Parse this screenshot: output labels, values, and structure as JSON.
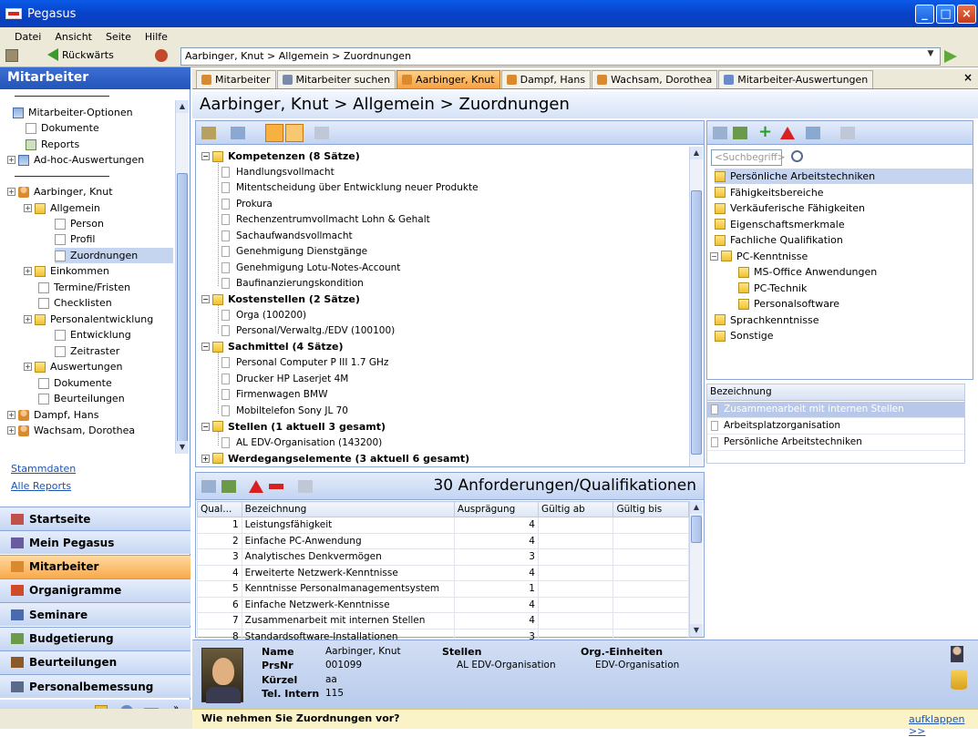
{
  "window": {
    "title": "Pegasus"
  },
  "menu": [
    "Datei",
    "Ansicht",
    "Seite",
    "Hilfe"
  ],
  "nav": {
    "back_label": "Rückwärts",
    "address": "Aarbinger, Knut > Allgemein > Zuordnungen"
  },
  "left": {
    "title": "Mitarbeiter",
    "tree": [
      {
        "label": "Mitarbeiter-Optionen",
        "icon": "table-icon"
      },
      {
        "label": "Dokumente",
        "icon": "document-icon"
      },
      {
        "label": "Reports",
        "icon": "report-icon"
      },
      {
        "label": "Ad-hoc-Auswertungen",
        "icon": "table-icon"
      },
      {
        "label": "Aarbinger, Knut",
        "icon": "person-icon"
      },
      {
        "label": "Allgemein",
        "icon": "folder-icon"
      },
      {
        "label": "Person",
        "icon": "document-icon"
      },
      {
        "label": "Profil",
        "icon": "document-icon"
      },
      {
        "label": "Zuordnungen",
        "icon": "document-icon",
        "selected": true
      },
      {
        "label": "Einkommen",
        "icon": "folder-icon"
      },
      {
        "label": "Termine/Fristen",
        "icon": "document-icon"
      },
      {
        "label": "Checklisten",
        "icon": "document-icon"
      },
      {
        "label": "Personalentwicklung",
        "icon": "folder-icon"
      },
      {
        "label": "Entwicklung",
        "icon": "document-icon"
      },
      {
        "label": "Zeitraster",
        "icon": "document-icon"
      },
      {
        "label": "Auswertungen",
        "icon": "folder-icon"
      },
      {
        "label": "Dokumente",
        "icon": "document-icon"
      },
      {
        "label": "Beurteilungen",
        "icon": "document-icon"
      },
      {
        "label": "Dampf, Hans",
        "icon": "person-icon"
      },
      {
        "label": "Wachsam, Dorothea",
        "icon": "person-icon"
      }
    ],
    "links": [
      "Stammdaten",
      "Alle Reports"
    ],
    "nav_buttons": [
      {
        "label": "Startseite",
        "icon": "home-icon"
      },
      {
        "label": "Mein Pegasus",
        "icon": "pegasus-icon"
      },
      {
        "label": "Mitarbeiter",
        "icon": "person-icon",
        "active": true
      },
      {
        "label": "Organigramme",
        "icon": "org-chart-icon"
      },
      {
        "label": "Seminare",
        "icon": "seminar-icon"
      },
      {
        "label": "Budgetierung",
        "icon": "money-icon"
      },
      {
        "label": "Beurteilungen",
        "icon": "appraisal-icon"
      },
      {
        "label": "Personalbemessung",
        "icon": "staffing-icon"
      }
    ]
  },
  "tabs": [
    {
      "label": "Mitarbeiter",
      "icon": "person-icon"
    },
    {
      "label": "Mitarbeiter suchen",
      "icon": "search-icon"
    },
    {
      "label": "Aarbinger, Knut",
      "icon": "person-icon",
      "active": true
    },
    {
      "label": "Dampf, Hans",
      "icon": "person-icon"
    },
    {
      "label": "Wachsam, Dorothea",
      "icon": "person-icon"
    },
    {
      "label": "Mitarbeiter-Auswertungen",
      "icon": "table-icon"
    }
  ],
  "header": {
    "breadcrumb": "Aarbinger, Knut > Allgemein > Zuordnungen"
  },
  "assignments": [
    {
      "group": "Kompetenzen (8 Sätze)",
      "items": [
        "Handlungsvollmacht",
        "Mitentscheidung über Entwicklung neuer Produkte",
        "Prokura",
        "Rechenzentrumvollmacht Lohn & Gehalt",
        "Sachaufwandsvollmacht",
        "Genehmigung Dienstgänge",
        "Genehmigung Lotu-Notes-Account",
        "Baufinanzierungskondition"
      ]
    },
    {
      "group": "Kostenstellen (2 Sätze)",
      "items": [
        "Orga (100200)",
        "Personal/Verwaltg./EDV (100100)"
      ]
    },
    {
      "group": "Sachmittel (4 Sätze)",
      "items": [
        "Personal Computer P III 1.7 GHz",
        "Drucker HP Laserjet 4M",
        "Firmenwagen BMW",
        "Mobiltelefon Sony JL 70"
      ]
    },
    {
      "group": "Stellen (1 aktuell 3 gesamt)",
      "items": [
        "AL EDV-Organisation (143200)"
      ]
    },
    {
      "group": "Werdegangselemente (3 aktuell 6 gesamt)",
      "items": []
    }
  ],
  "catalog": {
    "search_placeholder": "<Suchbegriff>",
    "items": [
      {
        "label": "Persönliche Arbeitstechniken",
        "level": 0,
        "selected": true
      },
      {
        "label": "Fähigkeitsbereiche",
        "level": 0
      },
      {
        "label": "Verkäuferische Fähigkeiten",
        "level": 0
      },
      {
        "label": "Eigenschaftsmerkmale",
        "level": 0
      },
      {
        "label": "Fachliche Qualifikation",
        "level": 0
      },
      {
        "label": "PC-Kenntnisse",
        "level": 0
      },
      {
        "label": "MS-Office Anwendungen",
        "level": 1
      },
      {
        "label": "PC-Technik",
        "level": 1
      },
      {
        "label": "Personalsoftware",
        "level": 1
      },
      {
        "label": "Sprachkenntnisse",
        "level": 0
      },
      {
        "label": "Sonstige",
        "level": 0
      }
    ],
    "list_header": "Bezeichnung",
    "list": [
      "Zusammenarbeit mit internen Stellen",
      "Arbeitsplatzorganisation",
      "Persönliche Arbeitstechniken"
    ]
  },
  "requirements": {
    "title": "30 Anforderungen/Qualifikationen",
    "columns": [
      "Qual...",
      "Bezeichnung",
      "Ausprägung",
      "Gültig ab",
      "Gültig bis"
    ],
    "rows": [
      [
        "1",
        "Leistungsfähigkeit",
        "4",
        "",
        ""
      ],
      [
        "2",
        "Einfache PC-Anwendung",
        "4",
        "",
        ""
      ],
      [
        "3",
        "Analytisches Denkvermögen",
        "3",
        "",
        ""
      ],
      [
        "4",
        "Erweiterte Netzwerk-Kenntnisse",
        "4",
        "",
        ""
      ],
      [
        "5",
        "Kenntnisse Personalmanagementsystem",
        "1",
        "",
        ""
      ],
      [
        "6",
        "Einfache Netzwerk-Kenntnisse",
        "4",
        "",
        ""
      ],
      [
        "7",
        "Zusammenarbeit mit internen Stellen",
        "4",
        "",
        ""
      ],
      [
        "8",
        "Standardsoftware-Installationen",
        "3",
        "",
        ""
      ]
    ]
  },
  "employee": {
    "name_label": "Name",
    "name": "Aarbinger, Knut",
    "prsnr_label": "PrsNr",
    "prsnr": "001099",
    "kuerzel_label": "Kürzel",
    "kuerzel": "aa",
    "tel_label": "Tel. Intern",
    "tel": "115",
    "stellen_label": "Stellen",
    "stellen": "AL EDV-Organisation",
    "org_label": "Org.-Einheiten",
    "org": "EDV-Organisation"
  },
  "footer": {
    "question": "Wie nehmen Sie Zuordnungen vor?",
    "expand": "aufklappen >>"
  }
}
